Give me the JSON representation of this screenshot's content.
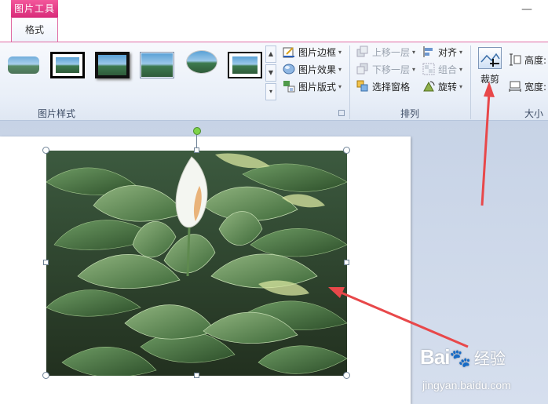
{
  "context_group": "图片工具",
  "active_tab": "格式",
  "window": {
    "minimize_glyph": "—"
  },
  "ribbon": {
    "picture_styles": {
      "label": "图片样式",
      "border": "图片边框",
      "effects": "图片效果",
      "layout": "图片版式"
    },
    "arrange": {
      "label": "排列",
      "bring_forward": "上移一层",
      "send_backward": "下移一层",
      "selection_pane": "选择窗格",
      "align": "对齐",
      "group": "组合",
      "rotate": "旋转"
    },
    "size": {
      "label": "大小",
      "crop": "裁剪",
      "height": "高度:",
      "width": "宽度:"
    }
  },
  "watermark": {
    "logo": "Bai",
    "logo_suffix": "du",
    "cn": "经验",
    "url": "jingyan.baidu.com"
  },
  "colors": {
    "accent_pink": "#e0317f",
    "annotation_red": "#e8484a",
    "handle_green": "#7ed34a"
  },
  "icons": [
    "picture-border-icon",
    "picture-effects-icon",
    "picture-layout-icon",
    "bring-forward-icon",
    "send-backward-icon",
    "selection-pane-icon",
    "align-icon",
    "group-icon",
    "rotate-icon",
    "crop-icon",
    "height-icon",
    "width-icon"
  ]
}
